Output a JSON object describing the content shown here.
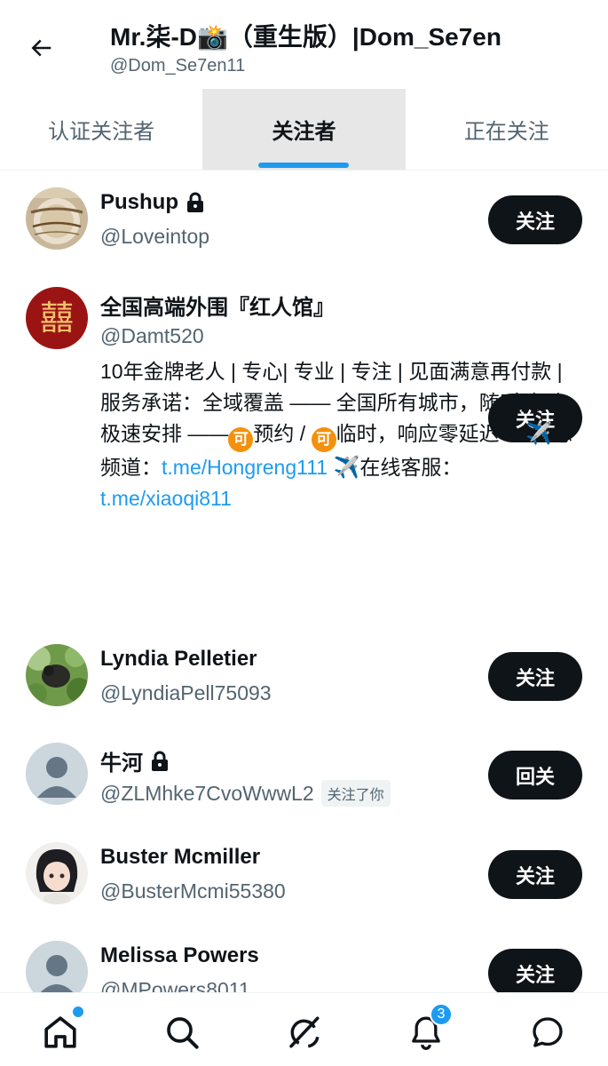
{
  "header": {
    "title": "Mr.柒-D📸（重生版）|Dom_Se7en",
    "handle": "@Dom_Se7en11"
  },
  "tabs": [
    {
      "label": "认证关注者",
      "active": false
    },
    {
      "label": "关注者",
      "active": true
    },
    {
      "label": "正在关注",
      "active": false
    }
  ],
  "users": [
    {
      "name": "Pushup",
      "handle": "@Loveintop",
      "locked": true,
      "button": "关注",
      "avatar": "champagne"
    },
    {
      "name": "全国高端外围『红人馆』",
      "handle": "@Damt520",
      "locked": false,
      "button": "关注",
      "avatar": "double-happiness",
      "avatar_text": "囍",
      "bio": {
        "p1": "10年金牌老人 | 专心| 专业 | 专注 | 见面满意再付款 | 服务承诺：全域覆盖 —— 全国所有城市，随叫随到，极速安排 ——",
        "ke_glyph": "可",
        "p2": "预约 / ",
        "p3": "临时，响应零延迟！ ",
        "plane": "✈️",
        "p4": "总频道：",
        "link1": "t.me/Hongreng111",
        "p5": "在线客服：",
        "link2": "t.me/xiaoqi811"
      }
    },
    {
      "name": "Lyndia Pelletier",
      "handle": "@LyndiaPell75093",
      "locked": false,
      "button": "关注",
      "avatar": "nature"
    },
    {
      "name": "牛河",
      "handle": "@ZLMhke7CvoWwwL2",
      "locked": true,
      "button": "回关",
      "follows_you": "关注了你",
      "avatar": "default"
    },
    {
      "name": "Buster Mcmiller",
      "handle": "@BusterMcmi55380",
      "locked": false,
      "button": "关注",
      "avatar": "anime"
    },
    {
      "name": "Melissa Powers",
      "handle": "@MPowers8011",
      "locked": false,
      "button": "关注",
      "avatar": "default"
    }
  ],
  "bottom_nav": {
    "items": [
      "home-icon",
      "search-icon",
      "grok-icon",
      "notifications-icon",
      "messages-icon"
    ],
    "notifications_count": "3"
  },
  "colors": {
    "accent": "#1d9bf0",
    "text": "#0f1419",
    "muted": "#536471",
    "button": "#0f1419"
  }
}
